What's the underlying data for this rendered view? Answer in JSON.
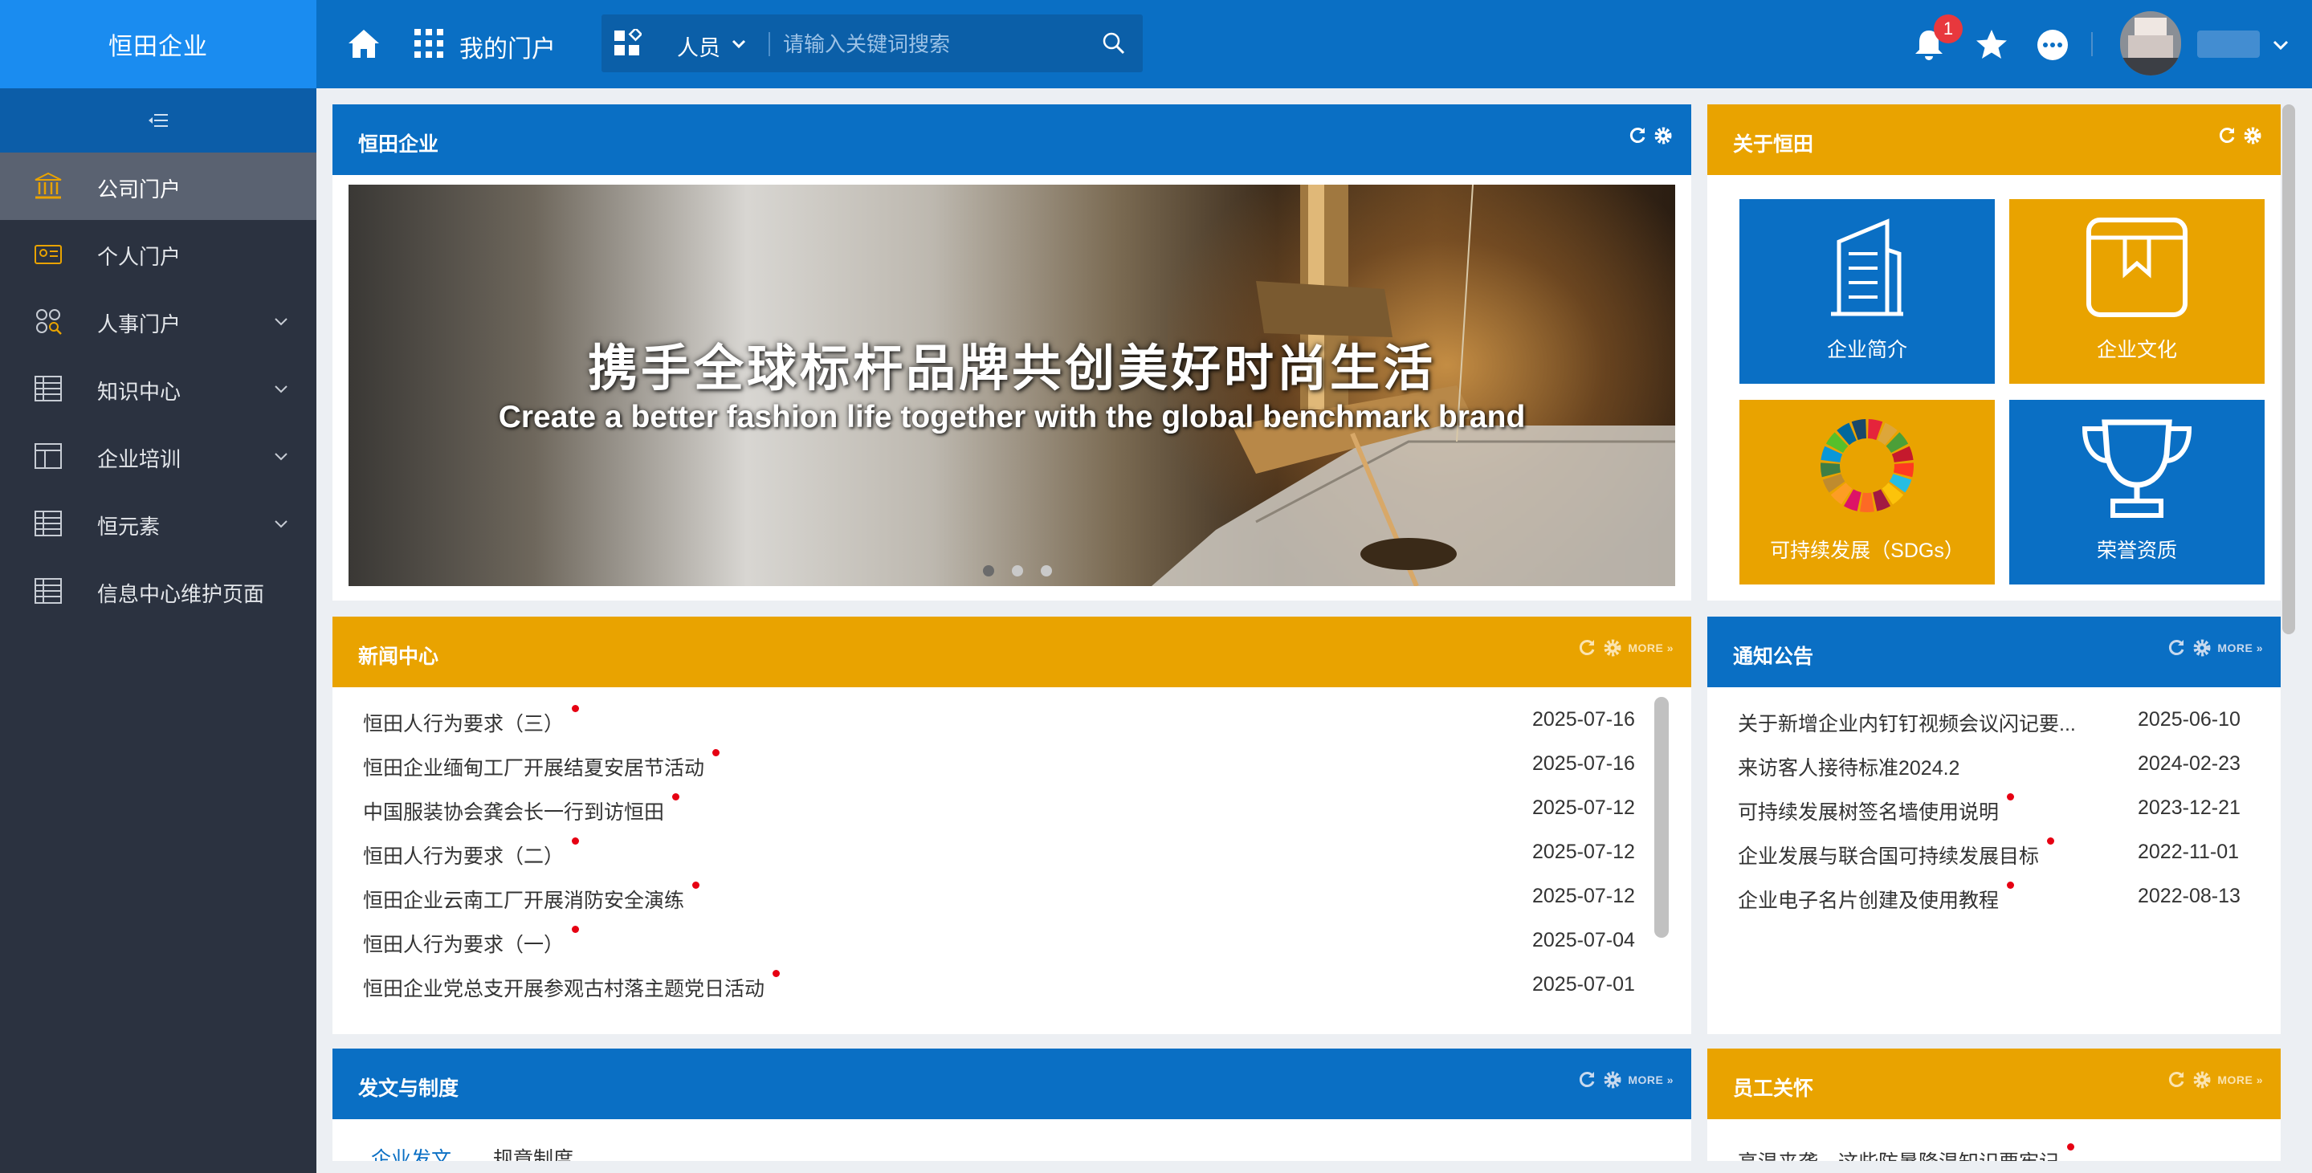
{
  "app": {
    "brand": "恒田企业",
    "portal_label": "我的门户"
  },
  "colors": {
    "primary_blue": "#0a6fc4",
    "brand_blue": "#1a8cf0",
    "gold": "#e9a300",
    "sidebar_bg": "#2b3240",
    "new_dot": "#e60012"
  },
  "search": {
    "type": "人员",
    "placeholder": "请输入关键词搜索"
  },
  "header": {
    "notification_count": "1"
  },
  "sidebar": {
    "items": [
      {
        "label": "公司门户",
        "icon": "bank-icon",
        "active": true
      },
      {
        "label": "个人门户",
        "icon": "id-card-icon"
      },
      {
        "label": "人事门户",
        "icon": "people-icon",
        "expandable": true
      },
      {
        "label": "知识中心",
        "icon": "table-icon",
        "expandable": true
      },
      {
        "label": "企业培训",
        "icon": "layout-icon",
        "expandable": true
      },
      {
        "label": "恒元素",
        "icon": "table-icon",
        "expandable": true
      },
      {
        "label": "信息中心维护页面",
        "icon": "table-icon"
      }
    ]
  },
  "panels": {
    "company": {
      "title": "恒田企业",
      "banner_cn": "携手全球标杆品牌共创美好时尚生活",
      "banner_en": "Create a better fashion life together with the global benchmark brand",
      "slides_total": 3,
      "slide_active": 1
    },
    "about": {
      "title": "关于恒田",
      "tiles": [
        {
          "label": "企业简介",
          "icon": "building-icon"
        },
        {
          "label": "企业文化",
          "icon": "book-icon"
        },
        {
          "label": "可持续发展（SDGs）",
          "icon": "sdg-wheel-icon"
        },
        {
          "label": "荣誉资质",
          "icon": "trophy-icon"
        }
      ]
    },
    "news": {
      "title": "新闻中心",
      "more_label": "MORE",
      "items": [
        {
          "title": "恒田人行为要求（三）",
          "date": "2025-07-16"
        },
        {
          "title": "恒田企业缅甸工厂开展结夏安居节活动",
          "date": "2025-07-16"
        },
        {
          "title": "中国服装协会龚会长一行到访恒田",
          "date": "2025-07-12"
        },
        {
          "title": "恒田人行为要求（二）",
          "date": "2025-07-12"
        },
        {
          "title": "恒田企业云南工厂开展消防安全演练",
          "date": "2025-07-12"
        },
        {
          "title": "恒田人行为要求（一）",
          "date": "2025-07-04"
        },
        {
          "title": "恒田企业党总支开展参观古村落主题党日活动",
          "date": "2025-07-01"
        }
      ]
    },
    "notice": {
      "title": "通知公告",
      "more_label": "MORE",
      "items": [
        {
          "title": "关于新增企业内钉钉视频会议闪记要...",
          "date": "2025-06-10",
          "new": false
        },
        {
          "title": "来访客人接待标准2024.2",
          "date": "2024-02-23",
          "new": false
        },
        {
          "title": "可持续发展树签名墙使用说明",
          "date": "2023-12-21",
          "new": true
        },
        {
          "title": "企业发展与联合国可持续发展目标",
          "date": "2022-11-01",
          "new": true
        },
        {
          "title": "企业电子名片创建及使用教程",
          "date": "2022-08-13",
          "new": true
        }
      ]
    },
    "docs": {
      "title": "发文与制度",
      "more_label": "MORE",
      "tabs": [
        {
          "label": "企业发文",
          "active": true
        },
        {
          "label": "规章制度",
          "active": false
        }
      ]
    },
    "care": {
      "title": "员工关怀",
      "more_label": "MORE",
      "items": [
        {
          "title": "高温来袭，这些防暑降温知识要牢记"
        }
      ]
    }
  }
}
